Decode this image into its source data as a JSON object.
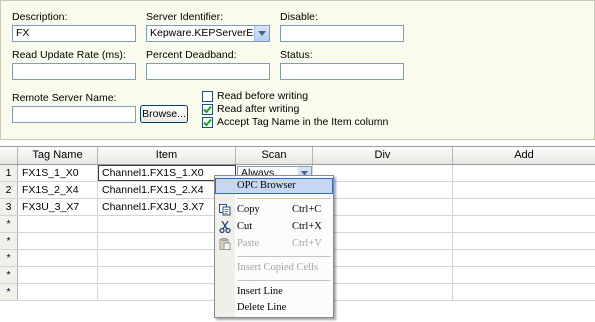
{
  "form": {
    "description_label": "Description:",
    "description_value": "FX",
    "server_identifier_label": "Server Identifier:",
    "server_identifier_value": "Kepware.KEPServerEX.\\",
    "disable_label": "Disable:",
    "disable_value": "",
    "read_update_rate_label": "Read Update Rate (ms):",
    "read_update_rate_value": "",
    "percent_deadband_label": "Percent Deadband:",
    "percent_deadband_value": "",
    "status_label": "Status:",
    "status_value": "",
    "remote_server_label": "Remote Server Name:",
    "remote_server_value": "",
    "browse_label": "Browse...",
    "checkboxes": [
      {
        "label": "Read before writing",
        "checked": false
      },
      {
        "label": "Read after writing",
        "checked": true
      },
      {
        "label": "Accept Tag Name in the Item column",
        "checked": true
      }
    ]
  },
  "grid": {
    "columns": [
      "Tag Name",
      "Item",
      "Scan",
      "Div",
      "Add"
    ],
    "rows": [
      {
        "num": "1",
        "tag": "FX1S_1_X0",
        "item": "Channel1.FX1S_1.X0",
        "scan": "Always"
      },
      {
        "num": "2",
        "tag": "FX1S_2_X4",
        "item": "Channel1.FX1S_2.X4",
        "scan": ""
      },
      {
        "num": "3",
        "tag": "FX3U_3_X7",
        "item": "Channel1.FX3U_3.X7",
        "scan": ""
      },
      {
        "num": "*",
        "tag": "",
        "item": "",
        "scan": ""
      },
      {
        "num": "*",
        "tag": "",
        "item": "",
        "scan": ""
      },
      {
        "num": "*",
        "tag": "",
        "item": "",
        "scan": ""
      },
      {
        "num": "*",
        "tag": "",
        "item": "",
        "scan": ""
      },
      {
        "num": "*",
        "tag": "",
        "item": "",
        "scan": ""
      }
    ]
  },
  "context_menu": {
    "opc_browser": "OPC Browser",
    "copy": "Copy",
    "copy_shortcut": "Ctrl+C",
    "cut": "Cut",
    "cut_shortcut": "Ctrl+X",
    "paste": "Paste",
    "paste_shortcut": "Ctrl+V",
    "insert_copied": "Insert Copied Cells",
    "insert_line": "Insert Line",
    "delete_line": "Delete Line"
  },
  "colors": {
    "panel_bg": "#fbfbed",
    "menu_highlight": "#c6d7f3",
    "field_border": "#7f9db9",
    "check_mark": "#21a121"
  }
}
